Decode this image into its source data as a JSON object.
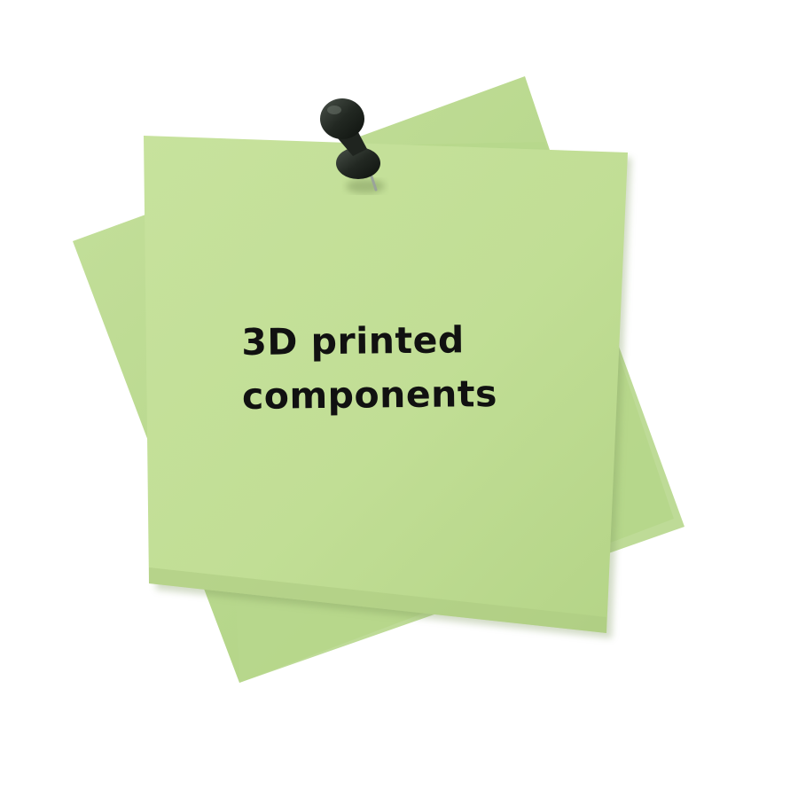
{
  "note": {
    "lines": [
      "3D printed",
      "components"
    ]
  },
  "colors": {
    "back_note": "#b9d98f",
    "front_note": "#c2df96",
    "front_note_shade": "#aecb82",
    "text": "#111111",
    "pin": "#1f241f",
    "background": "#ffffff"
  },
  "icons": {
    "pin": "push-pin-icon"
  }
}
